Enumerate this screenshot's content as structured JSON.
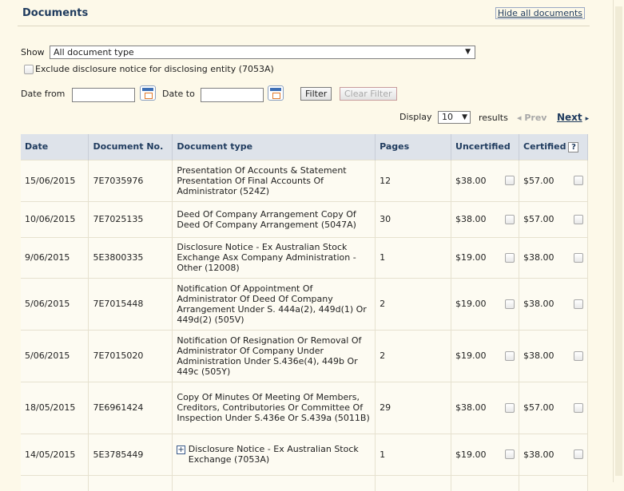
{
  "header": {
    "title": "Documents",
    "hide_all": "Hide all documents"
  },
  "filters": {
    "show_label": "Show",
    "show_value": "All document type",
    "exclude_label": "Exclude disclosure notice for disclosing entity (7053A)",
    "date_from_label": "Date from",
    "date_to_label": "Date to",
    "date_from_value": "",
    "date_to_value": "",
    "filter_btn": "Filter",
    "clear_btn": "Clear Filter"
  },
  "pagination": {
    "display_label": "Display",
    "display_value": "10",
    "results_label": "results",
    "prev": "Prev",
    "next": "Next"
  },
  "table": {
    "headers": [
      "Date",
      "Document No.",
      "Document type",
      "Pages",
      "Uncertified",
      "Certified"
    ],
    "rows": [
      {
        "date": "15/06/2015",
        "doc_no": "7E7035976",
        "type": "Presentation Of Accounts & Statement Presentation Of Final Accounts Of Administrator (524Z)",
        "pages": "12",
        "uncert": "$38.00",
        "cert": "$57.00"
      },
      {
        "date": "10/06/2015",
        "doc_no": "7E7025135",
        "type": "Deed Of Company Arrangement Copy Of Deed Of Company Arrangement (5047A)",
        "pages": "30",
        "uncert": "$38.00",
        "cert": "$57.00"
      },
      {
        "date": "9/06/2015",
        "doc_no": "5E3800335",
        "type": "Disclosure Notice - Ex Australian Stock Exchange Asx Company Administration - Other (12008)",
        "pages": "1",
        "uncert": "$19.00",
        "cert": "$38.00"
      },
      {
        "date": "5/06/2015",
        "doc_no": "7E7015448",
        "type": "Notification Of Appointment Of Administrator Of Deed Of Company Arrangement Under S. 444a(2), 449d(1) Or 449d(2) (505V)",
        "pages": "2",
        "uncert": "$19.00",
        "cert": "$38.00"
      },
      {
        "date": "5/06/2015",
        "doc_no": "7E7015020",
        "type": "Notification Of Resignation Or Removal Of Administrator Of Company Under Administration Under S.436e(4), 449b Or 449c (505Y)",
        "pages": "2",
        "uncert": "$19.00",
        "cert": "$38.00"
      },
      {
        "date": "18/05/2015",
        "doc_no": "7E6961424",
        "type": "Copy Of Minutes Of Meeting Of Members, Creditors, Contributories Or Committee Of Inspection Under S.436e Or S.439a (5011B)",
        "pages": "29",
        "uncert": "$38.00",
        "cert": "$57.00"
      },
      {
        "date": "14/05/2015",
        "doc_no": "5E3785449",
        "type": "Disclosure Notice - Ex Australian Stock Exchange (7053A)",
        "pages": "1",
        "uncert": "$19.00",
        "cert": "$38.00",
        "expand": true
      },
      {
        "date": "",
        "doc_no": "",
        "type": "",
        "pages": "",
        "uncert": "",
        "cert": ""
      }
    ]
  }
}
